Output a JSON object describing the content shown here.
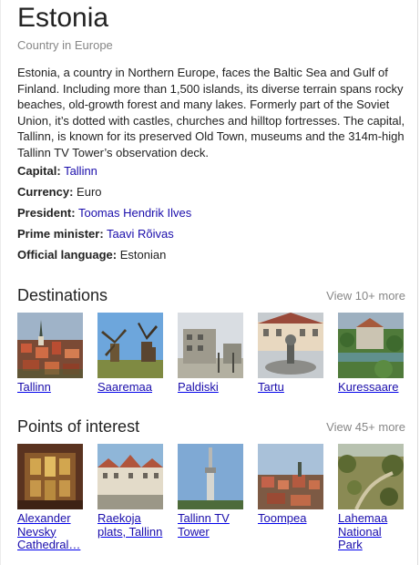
{
  "entity": {
    "title": "Estonia",
    "subtitle": "Country in Europe",
    "description": "Estonia, a country in Northern Europe, faces the Baltic Sea and Gulf of Finland. Including more than 1,500 islands, its diverse terrain spans rocky beaches, old-growth forest and many lakes. Formerly part of the Soviet Union, it’s dotted with castles, churches and hilltop fortresses. The capital, Tallinn, is known for its preserved Old Town, museums and the 314m-high Tallinn TV Tower’s observation deck."
  },
  "facts": [
    {
      "key": "Capital:",
      "value": "Tallinn"
    },
    {
      "key": "Currency:",
      "value": "Euro"
    },
    {
      "key": "President:",
      "value": "Toomas Hendrik Ilves"
    },
    {
      "key": "Prime minister:",
      "value": "Taavi Rõivas"
    },
    {
      "key": "Official language:",
      "value": "Estonian"
    }
  ],
  "destinations": {
    "title": "Destinations",
    "more": "View 10+ more",
    "items": [
      {
        "label": "Tallinn",
        "icon": "tallinn-photo"
      },
      {
        "label": "Saaremaa",
        "icon": "saaremaa-photo"
      },
      {
        "label": "Paldiski",
        "icon": "paldiski-photo"
      },
      {
        "label": "Tartu",
        "icon": "tartu-photo"
      },
      {
        "label": "Kuressaare",
        "icon": "kuressaare-photo"
      }
    ]
  },
  "points_of_interest": {
    "title": "Points of interest",
    "more": "View 45+ more",
    "items": [
      {
        "label": "Alexander Nevsky Cathedral…",
        "icon": "alexander-nevsky-cathedral-photo"
      },
      {
        "label": "Raekoja plats, Tallinn",
        "icon": "raekoja-plats-photo"
      },
      {
        "label": "Tallinn TV Tower",
        "icon": "tallinn-tv-tower-photo"
      },
      {
        "label": "Toompea",
        "icon": "toompea-photo"
      },
      {
        "label": "Lahemaa National Park",
        "icon": "lahemaa-national-park-photo"
      }
    ]
  },
  "colors": {
    "link": "#1a0dab",
    "muted": "#878787",
    "text": "#222222"
  }
}
